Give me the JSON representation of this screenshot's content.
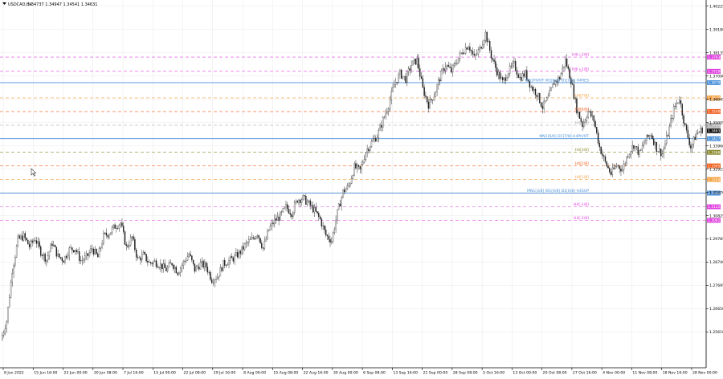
{
  "header": {
    "symbol_label": "USDCAD,H4",
    "ohlc_label": "1.34737 1.34947 1.34541 1.34631"
  },
  "colors": {
    "background": "#ffffff",
    "grid": "#e8e8e8",
    "candle": "#1a1a1a",
    "axis_text": "#000000",
    "pivot_blue": "#4a90d9",
    "magenta": "#e040e0",
    "orange": "#f5a040",
    "red_orange": "#f06020",
    "olive": "#8a8a30",
    "gray_dash": "#aaaaaa"
  },
  "chart_data": {
    "type": "candlestick",
    "symbol": "USDCAD",
    "timeframe": "H4",
    "ylim": [
      1.24,
      1.405
    ],
    "y_ticks": [
      "1.40225",
      "1.39180",
      "1.38135",
      "1.37090",
      "1.36045",
      "1.35005",
      "1.33960",
      "1.32915",
      "1.31870",
      "1.30825",
      "1.29785",
      "1.28740",
      "1.27695",
      "1.26650",
      "1.25610"
    ],
    "y_tick_values": [
      1.40225,
      1.3918,
      1.38135,
      1.3709,
      1.36045,
      1.35005,
      1.3396,
      1.32915,
      1.3187,
      1.30825,
      1.29785,
      1.2874,
      1.27695,
      1.2665,
      1.2561
    ],
    "x_ticks": [
      "8 Jun 2022",
      "15 Jun 16:00",
      "23 Jun 00:00",
      "30 Jun 08:00",
      "7 Jul 16:00",
      "15 Jul 00:00",
      "22 Jul 08:00",
      "29 Jul 16:00",
      "8 Aug 00:00",
      "15 Aug 08:00",
      "22 Aug 16:00",
      "30 Aug 00:00",
      "6 Sep 08:00",
      "13 Sep 16:00",
      "21 Sep 00:00",
      "28 Sep 08:00",
      "5 Oct 16:00",
      "13 Oct 00:00",
      "20 Oct 08:00",
      "27 Oct 16:00",
      "4 Nov 00:00",
      "11 Nov 08:00",
      "18 Nov 16:00",
      "28 Nov 00:00"
    ],
    "close_path": [
      {
        "x": 0,
        "y": 1.2525
      },
      {
        "x": 1,
        "y": 1.261
      },
      {
        "x": 2,
        "y": 1.284
      },
      {
        "x": 3,
        "y": 1.2975
      },
      {
        "x": 4,
        "y": 1.299
      },
      {
        "x": 5,
        "y": 1.2945
      },
      {
        "x": 6,
        "y": 1.298
      },
      {
        "x": 7,
        "y": 1.292
      },
      {
        "x": 8,
        "y": 1.2885
      },
      {
        "x": 9,
        "y": 1.296
      },
      {
        "x": 10,
        "y": 1.29
      },
      {
        "x": 11,
        "y": 1.2885
      },
      {
        "x": 12,
        "y": 1.293
      },
      {
        "x": 13,
        "y": 1.2935
      },
      {
        "x": 14,
        "y": 1.288
      },
      {
        "x": 15,
        "y": 1.2895
      },
      {
        "x": 16,
        "y": 1.2935
      },
      {
        "x": 17,
        "y": 1.2895
      },
      {
        "x": 18,
        "y": 1.299
      },
      {
        "x": 19,
        "y": 1.3005
      },
      {
        "x": 20,
        "y": 1.3035
      },
      {
        "x": 21,
        "y": 1.305
      },
      {
        "x": 22,
        "y": 1.294
      },
      {
        "x": 23,
        "y": 1.2985
      },
      {
        "x": 24,
        "y": 1.2885
      },
      {
        "x": 25,
        "y": 1.2905
      },
      {
        "x": 26,
        "y": 1.287
      },
      {
        "x": 27,
        "y": 1.2875
      },
      {
        "x": 28,
        "y": 1.286
      },
      {
        "x": 29,
        "y": 1.284
      },
      {
        "x": 30,
        "y": 1.287
      },
      {
        "x": 31,
        "y": 1.283
      },
      {
        "x": 32,
        "y": 1.287
      },
      {
        "x": 33,
        "y": 1.291
      },
      {
        "x": 34,
        "y": 1.284
      },
      {
        "x": 35,
        "y": 1.2865
      },
      {
        "x": 36,
        "y": 1.2855
      },
      {
        "x": 37,
        "y": 1.2795
      },
      {
        "x": 38,
        "y": 1.281
      },
      {
        "x": 39,
        "y": 1.2865
      },
      {
        "x": 40,
        "y": 1.288
      },
      {
        "x": 41,
        "y": 1.2895
      },
      {
        "x": 42,
        "y": 1.292
      },
      {
        "x": 43,
        "y": 1.2955
      },
      {
        "x": 44,
        "y": 1.2975
      },
      {
        "x": 45,
        "y": 1.3005
      },
      {
        "x": 46,
        "y": 1.2935
      },
      {
        "x": 47,
        "y": 1.302
      },
      {
        "x": 48,
        "y": 1.306
      },
      {
        "x": 49,
        "y": 1.308
      },
      {
        "x": 50,
        "y": 1.312
      },
      {
        "x": 51,
        "y": 1.3095
      },
      {
        "x": 52,
        "y": 1.3155
      },
      {
        "x": 53,
        "y": 1.316
      },
      {
        "x": 54,
        "y": 1.3135
      },
      {
        "x": 55,
        "y": 1.3105
      },
      {
        "x": 56,
        "y": 1.3065
      },
      {
        "x": 57,
        "y": 1.2995
      },
      {
        "x": 58,
        "y": 1.297
      },
      {
        "x": 59,
        "y": 1.3095
      },
      {
        "x": 60,
        "y": 1.319
      },
      {
        "x": 61,
        "y": 1.3215
      },
      {
        "x": 62,
        "y": 1.33
      },
      {
        "x": 63,
        "y": 1.3285
      },
      {
        "x": 64,
        "y": 1.337
      },
      {
        "x": 65,
        "y": 1.341
      },
      {
        "x": 66,
        "y": 1.344
      },
      {
        "x": 67,
        "y": 1.351
      },
      {
        "x": 68,
        "y": 1.358
      },
      {
        "x": 69,
        "y": 1.367
      },
      {
        "x": 70,
        "y": 1.372
      },
      {
        "x": 71,
        "y": 1.3695
      },
      {
        "x": 72,
        "y": 1.376
      },
      {
        "x": 73,
        "y": 1.378
      },
      {
        "x": 74,
        "y": 1.365
      },
      {
        "x": 75,
        "y": 1.358
      },
      {
        "x": 76,
        "y": 1.3625
      },
      {
        "x": 77,
        "y": 1.37
      },
      {
        "x": 78,
        "y": 1.376
      },
      {
        "x": 79,
        "y": 1.373
      },
      {
        "x": 80,
        "y": 1.378
      },
      {
        "x": 81,
        "y": 1.382
      },
      {
        "x": 82,
        "y": 1.385
      },
      {
        "x": 83,
        "y": 1.379
      },
      {
        "x": 84,
        "y": 1.383
      },
      {
        "x": 85,
        "y": 1.39
      },
      {
        "x": 86,
        "y": 1.38
      },
      {
        "x": 87,
        "y": 1.373
      },
      {
        "x": 88,
        "y": 1.368
      },
      {
        "x": 89,
        "y": 1.373
      },
      {
        "x": 90,
        "y": 1.376
      },
      {
        "x": 91,
        "y": 1.37
      },
      {
        "x": 92,
        "y": 1.372
      },
      {
        "x": 93,
        "y": 1.366
      },
      {
        "x": 94,
        "y": 1.363
      },
      {
        "x": 95,
        "y": 1.357
      },
      {
        "x": 96,
        "y": 1.361
      },
      {
        "x": 97,
        "y": 1.368
      },
      {
        "x": 98,
        "y": 1.37
      },
      {
        "x": 99,
        "y": 1.378
      },
      {
        "x": 100,
        "y": 1.369
      },
      {
        "x": 101,
        "y": 1.356
      },
      {
        "x": 102,
        "y": 1.349
      },
      {
        "x": 103,
        "y": 1.355
      },
      {
        "x": 104,
        "y": 1.351
      },
      {
        "x": 105,
        "y": 1.339
      },
      {
        "x": 106,
        "y": 1.332
      },
      {
        "x": 107,
        "y": 1.327
      },
      {
        "x": 108,
        "y": 1.331
      },
      {
        "x": 109,
        "y": 1.329
      },
      {
        "x": 110,
        "y": 1.336
      },
      {
        "x": 111,
        "y": 1.34
      },
      {
        "x": 112,
        "y": 1.336
      },
      {
        "x": 113,
        "y": 1.342
      },
      {
        "x": 114,
        "y": 1.345
      },
      {
        "x": 115,
        "y": 1.3385
      },
      {
        "x": 116,
        "y": 1.336
      },
      {
        "x": 117,
        "y": 1.345
      },
      {
        "x": 118,
        "y": 1.356
      },
      {
        "x": 119,
        "y": 1.361
      },
      {
        "x": 120,
        "y": 1.348
      },
      {
        "x": 121,
        "y": 1.339
      },
      {
        "x": 122,
        "y": 1.345
      },
      {
        "x": 123,
        "y": 1.347
      }
    ],
    "levels": [
      {
        "label": "H4[+2/8]",
        "price_label": "1.37939",
        "value": 1.37939,
        "color": "#e040e0",
        "style": "dash"
      },
      {
        "label": "H4[+1/8]",
        "price_label": "1.37299",
        "value": 1.37299,
        "color": "#e040e0",
        "style": "dash"
      },
      {
        "label": "MN1PIVOT W1[8/8] D1[8/8] H4RES",
        "price_label": "1.36792",
        "value": 1.36792,
        "color": "#4a90d9",
        "style": "solid"
      },
      {
        "label": "H4[7/8]",
        "price_label": "1.36108",
        "value": 1.36108,
        "color": "#f5a040",
        "style": "dash"
      },
      {
        "label": "H4[6/8]",
        "price_label": "1.35496",
        "value": 1.35496,
        "color": "#f06020",
        "style": "dash"
      },
      {
        "label": "H4[5/8]",
        "price_label": "1.34883",
        "value": 1.34883,
        "color": "#aaaaaa",
        "style": "dash"
      },
      {
        "label": "",
        "price_label": "1.34631",
        "value": 1.34631,
        "color": "#111111",
        "style": "none"
      },
      {
        "label": "MN1[6/8] D1[7/8] H4PIVOT",
        "price_label": "1.34277",
        "value": 1.34277,
        "color": "#4a90d9",
        "style": "solid"
      },
      {
        "label": "H4[3/8]",
        "price_label": "1.33665",
        "value": 1.33665,
        "color": "#8a8a30",
        "style": "dash"
      },
      {
        "label": "H4[2/8]",
        "price_label": "1.33057",
        "value": 1.33057,
        "color": "#f06020",
        "style": "dash"
      },
      {
        "label": "H4[1/8]",
        "price_label": "1.32446",
        "value": 1.32446,
        "color": "#f5a040",
        "style": "dash"
      },
      {
        "label": "MN1[3/8] W1[6/8] D1[6/8] H4SUP",
        "price_label": "1.31835",
        "value": 1.31835,
        "color": "#4a90d9",
        "style": "solid"
      },
      {
        "label": "H4[-1/8]",
        "price_label": "1.31223",
        "value": 1.31223,
        "color": "#e040e0",
        "style": "dash"
      },
      {
        "label": "H4[-2/8]",
        "price_label": "1.30615",
        "value": 1.30615,
        "color": "#e040e0",
        "style": "dash"
      }
    ]
  }
}
